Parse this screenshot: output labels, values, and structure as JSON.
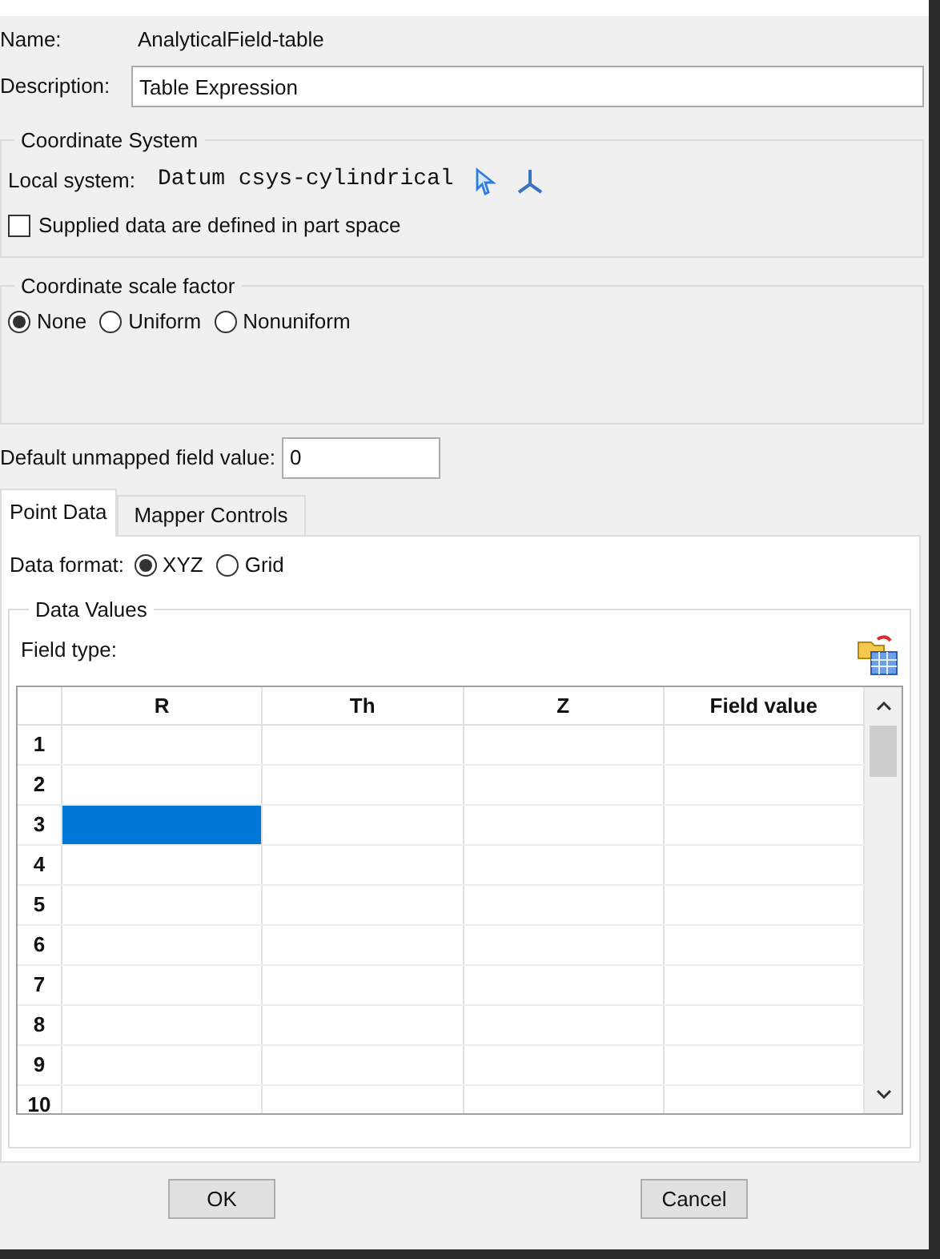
{
  "name_label": "Name:",
  "name_value": "AnalyticalField-table",
  "description": {
    "label": "Description:",
    "value": "Table Expression"
  },
  "coordinate_system": {
    "title": "Coordinate System",
    "local_label": "Local system:",
    "local_value": "Datum csys-cylindrical",
    "part_space": {
      "label": "Supplied data are defined in part space",
      "checked": false
    }
  },
  "scale_factor": {
    "title": "Coordinate scale factor",
    "options": [
      {
        "label": "None",
        "selected": true
      },
      {
        "label": "Uniform",
        "selected": false
      },
      {
        "label": "Nonuniform",
        "selected": false
      }
    ]
  },
  "default_value": {
    "label": "Default unmapped field value:",
    "value": "0"
  },
  "tabs": [
    {
      "label": "Point Data",
      "selected": true
    },
    {
      "label": "Mapper Controls",
      "selected": false
    }
  ],
  "data_format": {
    "label": "Data format:",
    "options": [
      {
        "label": "XYZ",
        "selected": true
      },
      {
        "label": "Grid",
        "selected": false
      }
    ]
  },
  "data_values": {
    "title": "Data Values",
    "field_type_label": "Field type:"
  },
  "table": {
    "columns": [
      "R",
      "Th",
      "Z",
      "Field value"
    ],
    "rows": [
      {
        "label": "1",
        "cells": [
          {
            "selected": false
          },
          {
            "selected": false
          },
          {
            "selected": false
          },
          {
            "selected": false
          }
        ]
      },
      {
        "label": "2",
        "cells": [
          {
            "selected": false
          },
          {
            "selected": false
          },
          {
            "selected": false
          },
          {
            "selected": false
          }
        ]
      },
      {
        "label": "3",
        "cells": [
          {
            "selected": true
          },
          {
            "selected": false
          },
          {
            "selected": false
          },
          {
            "selected": false
          }
        ]
      },
      {
        "label": "4",
        "cells": [
          {
            "selected": false
          },
          {
            "selected": false
          },
          {
            "selected": false
          },
          {
            "selected": false
          }
        ]
      },
      {
        "label": "5",
        "cells": [
          {
            "selected": false
          },
          {
            "selected": false
          },
          {
            "selected": false
          },
          {
            "selected": false
          }
        ]
      },
      {
        "label": "6",
        "cells": [
          {
            "selected": false
          },
          {
            "selected": false
          },
          {
            "selected": false
          },
          {
            "selected": false
          }
        ]
      },
      {
        "label": "7",
        "cells": [
          {
            "selected": false
          },
          {
            "selected": false
          },
          {
            "selected": false
          },
          {
            "selected": false
          }
        ]
      },
      {
        "label": "8",
        "cells": [
          {
            "selected": false
          },
          {
            "selected": false
          },
          {
            "selected": false
          },
          {
            "selected": false
          }
        ]
      },
      {
        "label": "9",
        "cells": [
          {
            "selected": false
          },
          {
            "selected": false
          },
          {
            "selected": false
          },
          {
            "selected": false
          }
        ]
      },
      {
        "label": "10",
        "cells": [
          {
            "selected": false
          },
          {
            "selected": false
          },
          {
            "selected": false
          },
          {
            "selected": false
          }
        ]
      }
    ]
  },
  "buttons": [
    "OK",
    "Cancel"
  ]
}
